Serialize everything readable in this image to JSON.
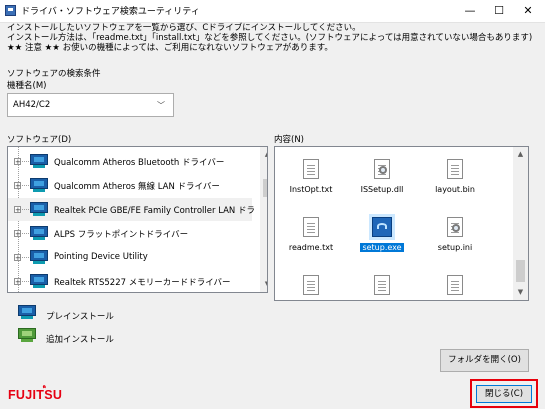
{
  "window": {
    "title": "ドライバ・ソフトウェア検索ユーティリティ",
    "minimize": "—",
    "maximize": "☐",
    "close": "✕"
  },
  "instructions": [
    "インストールしたいソフトウェアを一覧から選び、Cドライブにインストールしてください。",
    "インストール方法は、「readme.txt」「install.txt」などを参照してください。(ソフトウェアによっては用意されていない場合もあります)",
    "★★ 注意 ★★ お使いの機種によっては、ご利用になれないソフトウェアがあります。"
  ],
  "search": {
    "section_label": "ソフトウェアの検索条件",
    "model_label": "機種名(M)",
    "model_value": "AH42/C2"
  },
  "software": {
    "label": "ソフトウェア(D)",
    "items": [
      {
        "label": "Qualcomm Atheros Bluetooth ドライバー",
        "type": "preinstall"
      },
      {
        "label": "Qualcomm Atheros 無線 LAN ドライバー",
        "type": "preinstall"
      },
      {
        "label": "Realtek PCIe GBE/FE Family Controller LAN ドラ",
        "type": "preinstall",
        "selected": true
      },
      {
        "label": "ALPS フラットポイントドライバー",
        "type": "preinstall"
      },
      {
        "label": "Pointing Device Utility",
        "type": "preinstall"
      },
      {
        "label": "Realtek RTS5227 メモリーカードドライバー",
        "type": "preinstall"
      }
    ]
  },
  "contents": {
    "label": "内容(N)",
    "files": [
      {
        "name": "InstOpt.txt",
        "icon": "text-file-icon"
      },
      {
        "name": "ISSetup.dll",
        "icon": "settings-file-icon"
      },
      {
        "name": "layout.bin",
        "icon": "file-icon"
      },
      {
        "name": "readme.txt",
        "icon": "text-file-icon"
      },
      {
        "name": "setup.exe",
        "icon": "installer-icon",
        "selected": true
      },
      {
        "name": "setup.ini",
        "icon": "settings-file-icon"
      }
    ]
  },
  "legend": {
    "preinstall": "プレインストール",
    "additional": "追加インストール"
  },
  "buttons": {
    "open_folder": "フォルダを開く(O)",
    "close": "閉じる(C)"
  },
  "logo": "FUJITSU",
  "colors": {
    "selection": "#0078d7",
    "highlight_frame": "#e8000b",
    "logo_red": "#e60012"
  }
}
